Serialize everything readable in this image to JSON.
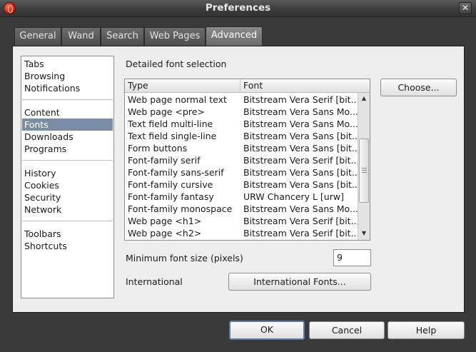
{
  "window": {
    "title": "Preferences"
  },
  "tabs": [
    {
      "label": "General"
    },
    {
      "label": "Wand"
    },
    {
      "label": "Search"
    },
    {
      "label": "Web Pages"
    },
    {
      "label": "Advanced"
    }
  ],
  "sidebar": {
    "items": [
      {
        "label": "Tabs"
      },
      {
        "label": "Browsing"
      },
      {
        "label": "Notifications"
      },
      {
        "label": "Content"
      },
      {
        "label": "Fonts"
      },
      {
        "label": "Downloads"
      },
      {
        "label": "Programs"
      },
      {
        "label": "History"
      },
      {
        "label": "Cookies"
      },
      {
        "label": "Security"
      },
      {
        "label": "Network"
      },
      {
        "label": "Toolbars"
      },
      {
        "label": "Shortcuts"
      }
    ],
    "selected": "Fonts"
  },
  "fonts": {
    "section_title": "Detailed font selection",
    "choose_label": "Choose...",
    "columns": {
      "type": "Type",
      "font": "Font"
    },
    "rows": [
      {
        "type": "Web page normal text",
        "font": "Bitstream Vera Serif [bit..."
      },
      {
        "type": "Web page <pre>",
        "font": "Bitstream Vera Sans Mo..."
      },
      {
        "type": "Text field multi-line",
        "font": "Bitstream Vera Sans Mo..."
      },
      {
        "type": "Text field single-line",
        "font": "Bitstream Vera Sans [bit..."
      },
      {
        "type": "Form buttons",
        "font": "Bitstream Vera Sans [bit..."
      },
      {
        "type": "Font-family serif",
        "font": "Bitstream Vera Serif [bit..."
      },
      {
        "type": "Font-family sans-serif",
        "font": "Bitstream Vera Sans [bit..."
      },
      {
        "type": "Font-family cursive",
        "font": "Bitstream Vera Sans [bit..."
      },
      {
        "type": "Font-family fantasy",
        "font": "URW Chancery L [urw]"
      },
      {
        "type": "Font-family monospace",
        "font": "Bitstream Vera Sans Mo..."
      },
      {
        "type": "Web page <h1>",
        "font": "Bitstream Vera Serif [bit..."
      },
      {
        "type": "Web page <h2>",
        "font": "Bitstream Vera Serif [bit..."
      }
    ],
    "min_size_label": "Minimum font size (pixels)",
    "min_size_value": "9",
    "international_label": "International",
    "international_button": "International Fonts..."
  },
  "footer": {
    "ok": "OK",
    "cancel": "Cancel",
    "help": "Help"
  }
}
